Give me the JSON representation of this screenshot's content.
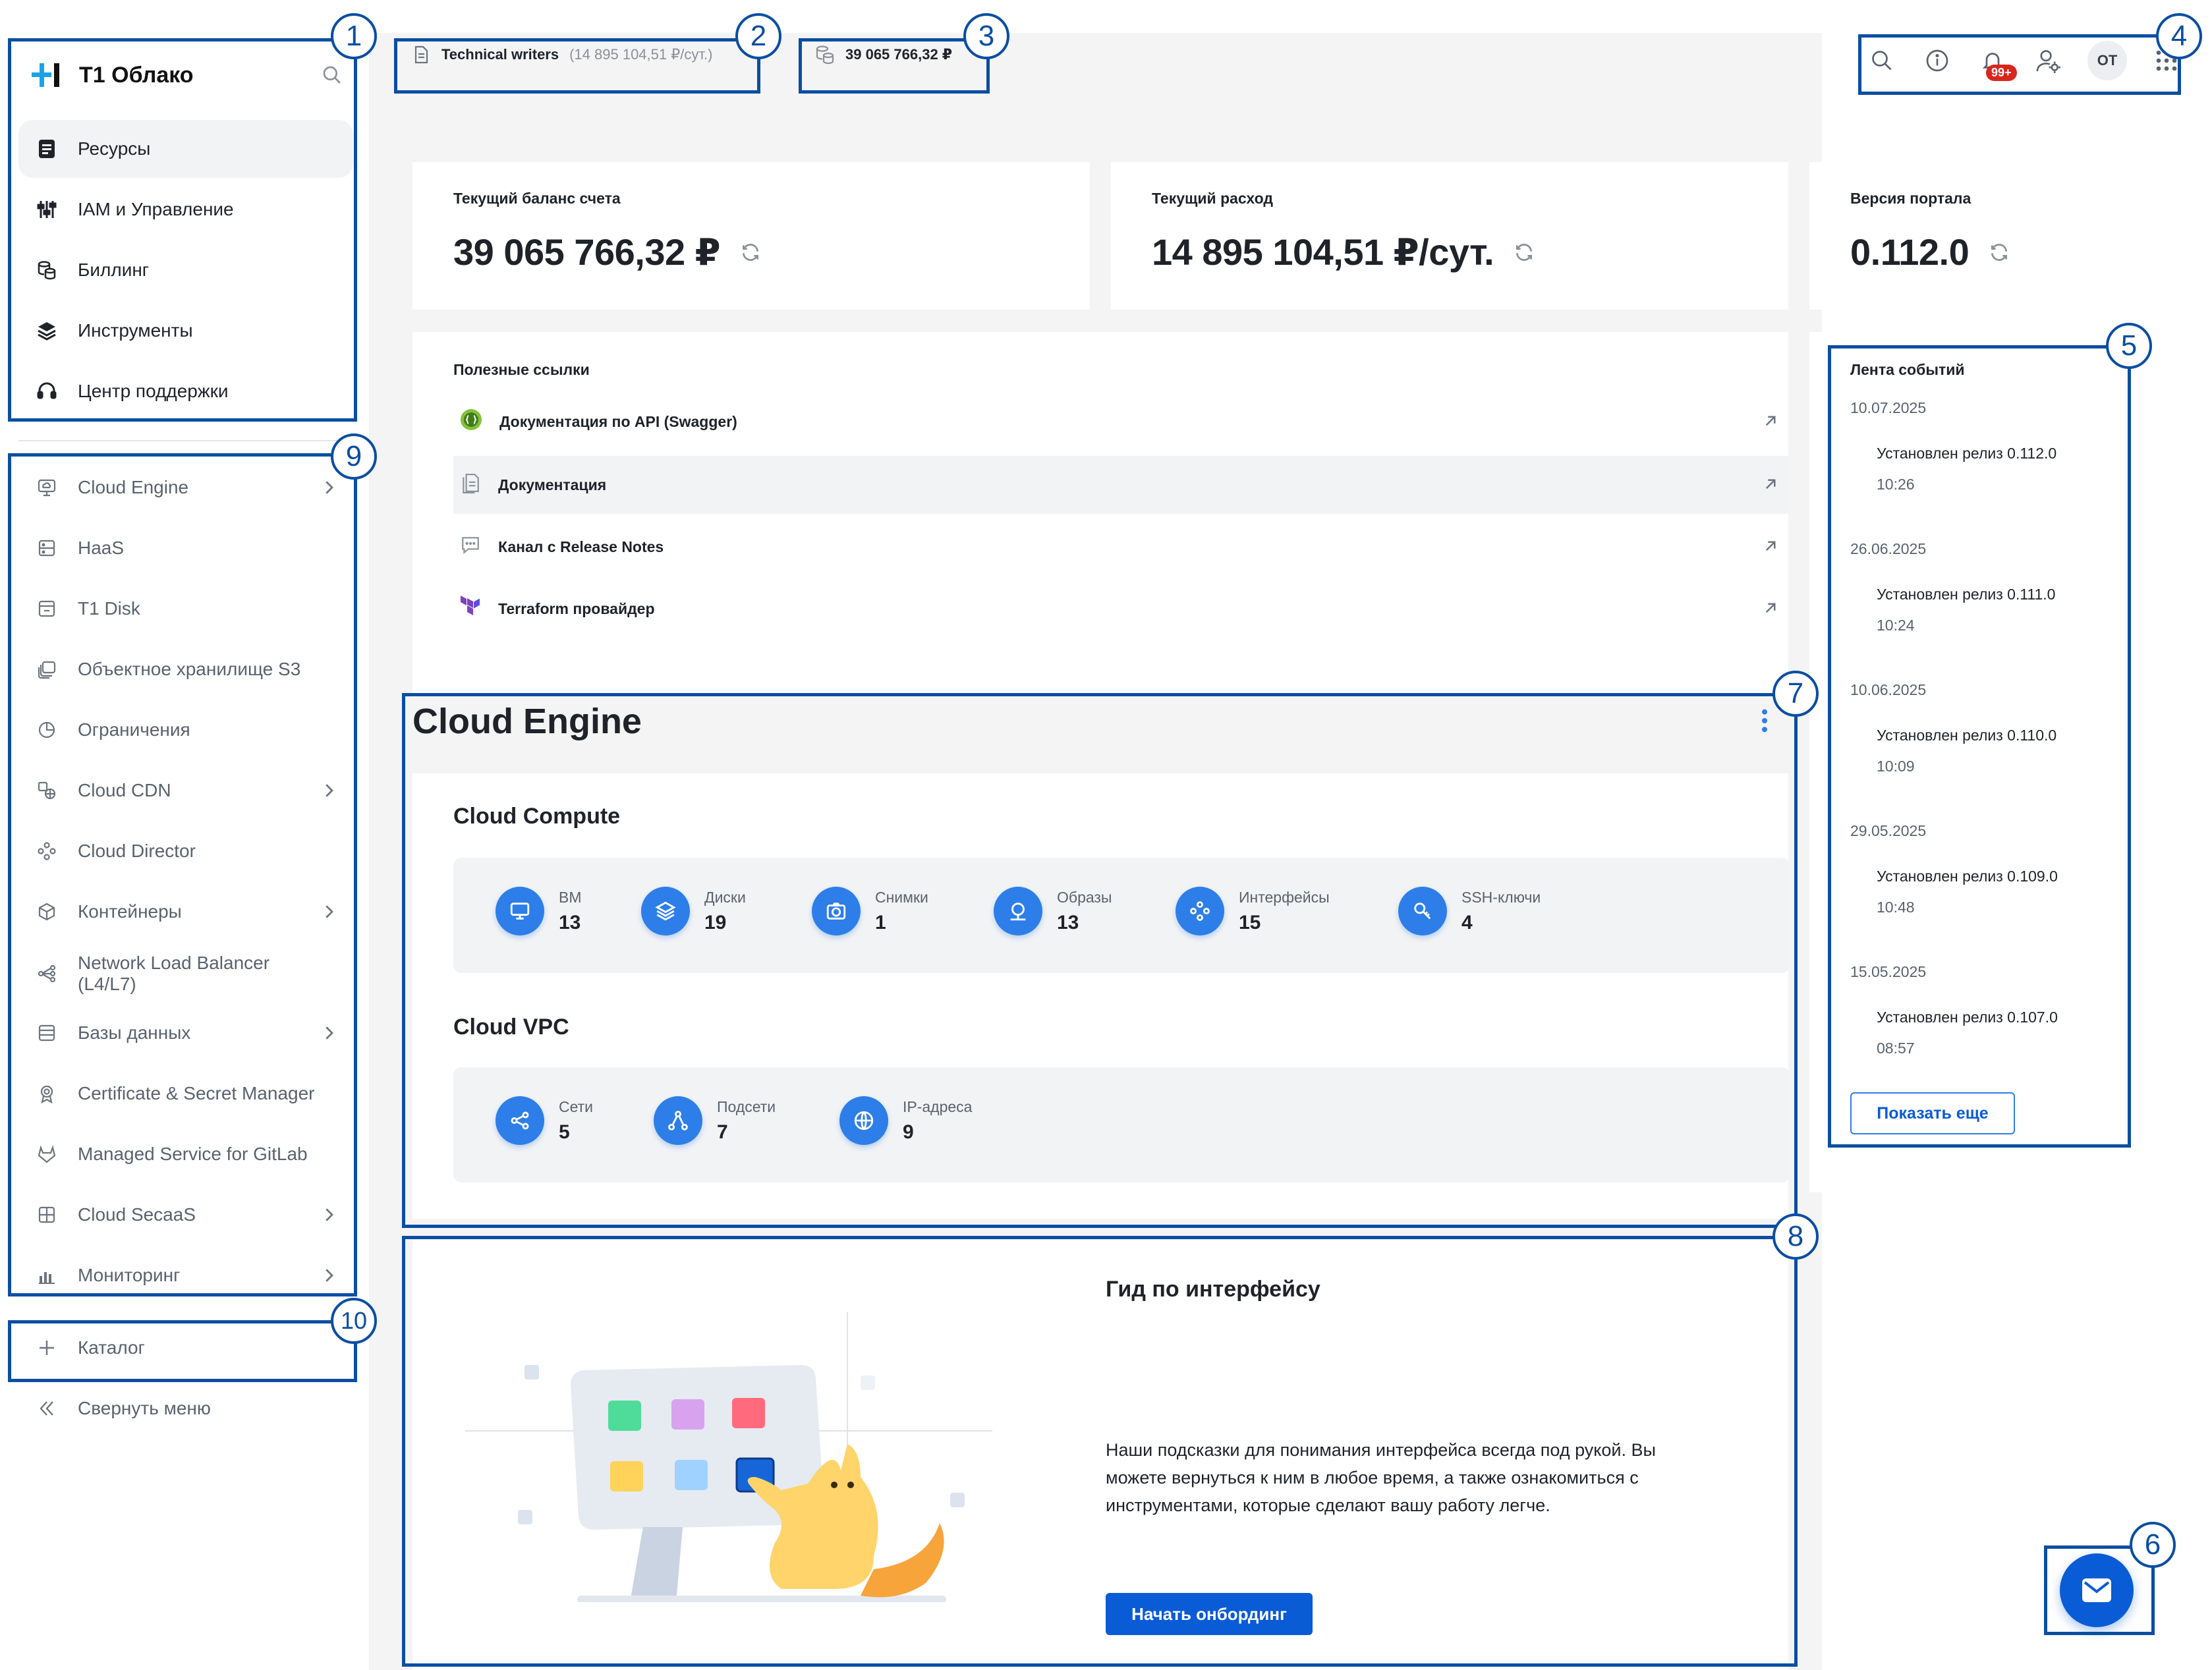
{
  "brand": {
    "logo_text": "T1 Облако"
  },
  "sidebar": {
    "top_items": [
      {
        "label": "Ресурсы",
        "icon": "resources-icon"
      },
      {
        "label": "IAM и Управление",
        "icon": "sliders-icon"
      },
      {
        "label": "Биллинг",
        "icon": "coins-icon"
      },
      {
        "label": "Инструменты",
        "icon": "layers-icon"
      },
      {
        "label": "Центр поддержки",
        "icon": "headset-icon"
      }
    ],
    "services": [
      {
        "label": "Cloud Engine",
        "icon": "cloud-engine-icon",
        "chevron": true
      },
      {
        "label": "HaaS",
        "icon": "server-icon",
        "chevron": false
      },
      {
        "label": "T1 Disk",
        "icon": "disk-icon",
        "chevron": false
      },
      {
        "label": "Объектное хранилище S3",
        "icon": "storage-icon",
        "chevron": false
      },
      {
        "label": "Ограничения",
        "icon": "pie-icon",
        "chevron": false
      },
      {
        "label": "Cloud CDN",
        "icon": "cdn-icon",
        "chevron": true
      },
      {
        "label": "Cloud Director",
        "icon": "director-icon",
        "chevron": false
      },
      {
        "label": "Контейнеры",
        "icon": "container-icon",
        "chevron": true
      },
      {
        "label": "Network Load Balancer (L4/L7)",
        "icon": "balancer-icon",
        "chevron": false
      },
      {
        "label": "Базы данных",
        "icon": "database-icon",
        "chevron": true
      },
      {
        "label": "Certificate & Secret Manager",
        "icon": "certificate-icon",
        "chevron": false
      },
      {
        "label": "Managed Service for GitLab",
        "icon": "gitlab-icon",
        "chevron": false
      },
      {
        "label": "Cloud SecaaS",
        "icon": "secaas-icon",
        "chevron": true
      },
      {
        "label": "Мониторинг",
        "icon": "monitoring-icon",
        "chevron": true
      }
    ],
    "catalog_label": "Каталог",
    "collapse_label": "Свернуть меню"
  },
  "topbar": {
    "project_name": "Technical writers",
    "project_rate": "(14 895 104,51 ₽/сут.)",
    "balance": "39 065 766,32 ₽",
    "notifications_badge": "99+",
    "avatar_initials": "OT"
  },
  "kpis": [
    {
      "label": "Текущий баланс счета",
      "value": "39 065 766,32 ₽"
    },
    {
      "label": "Текущий расход",
      "value": "14 895 104,51 ₽/сут."
    },
    {
      "label": "Версия портала",
      "value": "0.112.0"
    }
  ],
  "useful_links": {
    "title": "Полезные ссылки",
    "items": [
      {
        "label": "Документация по API (Swagger)",
        "icon": "swagger-icon"
      },
      {
        "label": "Документация",
        "icon": "document-icon"
      },
      {
        "label": "Канал с Release Notes",
        "icon": "chat-icon"
      },
      {
        "label": "Terraform провайдер",
        "icon": "terraform-icon"
      }
    ]
  },
  "events": {
    "title": "Лента событий",
    "items": [
      {
        "date": "10.07.2025",
        "title": "Установлен релиз 0.112.0",
        "time": "10:26"
      },
      {
        "date": "26.06.2025",
        "title": "Установлен релиз 0.111.0",
        "time": "10:24"
      },
      {
        "date": "10.06.2025",
        "title": "Установлен релиз 0.110.0",
        "time": "10:09"
      },
      {
        "date": "29.05.2025",
        "title": "Установлен релиз 0.109.0",
        "time": "10:48"
      },
      {
        "date": "15.05.2025",
        "title": "Установлен релиз 0.107.0",
        "time": "08:57"
      }
    ],
    "show_more": "Показать еще"
  },
  "cloud_engine": {
    "title": "Cloud Engine",
    "compute": {
      "title": "Cloud Compute",
      "metrics": [
        {
          "label": "ВМ",
          "value": "13",
          "icon": "monitor-icon"
        },
        {
          "label": "Диски",
          "value": "19",
          "icon": "layers-icon"
        },
        {
          "label": "Снимки",
          "value": "1",
          "icon": "camera-icon"
        },
        {
          "label": "Образы",
          "value": "13",
          "icon": "image-icon"
        },
        {
          "label": "Интерфейсы",
          "value": "15",
          "icon": "interfaces-icon"
        },
        {
          "label": "SSH-ключи",
          "value": "4",
          "icon": "key-icon"
        }
      ]
    },
    "vpc": {
      "title": "Cloud VPC",
      "metrics": [
        {
          "label": "Сети",
          "value": "5",
          "icon": "share-icon"
        },
        {
          "label": "Подсети",
          "value": "7",
          "icon": "subnet-icon"
        },
        {
          "label": "IP-адреса",
          "value": "9",
          "icon": "globe-icon"
        }
      ]
    }
  },
  "guide": {
    "title": "Гид по интерфейсу",
    "text": "Наши подсказки для понимания интерфейса всегда под рукой. Вы можете вернуться к ним в любое время, а также ознакомиться с инструментами, которые сделают вашу работу легче.",
    "button": "Начать онбординг"
  },
  "callouts": [
    "1",
    "2",
    "3",
    "4",
    "5",
    "6",
    "7",
    "8",
    "9",
    "10"
  ],
  "colors": {
    "accent": "#0a5bd6",
    "callout": "#0b4ea2",
    "icon_blue": "#2d7ee8",
    "badge_red": "#d9261c"
  }
}
